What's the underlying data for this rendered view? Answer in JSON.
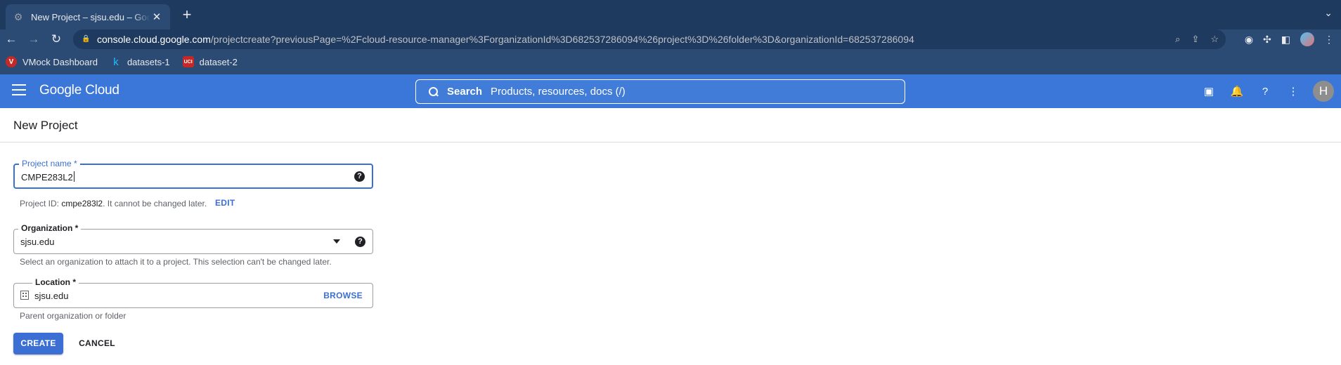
{
  "browser": {
    "tab_title": "New Project – sjsu.edu – Google Cloud console",
    "tab_close": "✕",
    "new_tab": "+",
    "url_host": "console.cloud.google.com",
    "url_path": "/projectcreate?previousPage=%2Fcloud-resource-manager%3ForganizationId%3D682537286094%26project%3D%26folder%3D&organizationId=682537286094",
    "bookmarks": [
      {
        "label": "VMock Dashboard",
        "icon": "vmock-icon",
        "color": "#c62828"
      },
      {
        "label": "datasets-1",
        "icon": "kaggle-icon",
        "color": "#20beff"
      },
      {
        "label": "dataset-2",
        "icon": "uci-icon",
        "color": "#c62828"
      }
    ]
  },
  "header": {
    "logo": "Google Cloud",
    "search_label": "Search",
    "search_placeholder": "Products, resources, docs (/)",
    "avatar_initial": "H",
    "accent_color": "#3b77d8"
  },
  "page": {
    "title": "New Project",
    "project_name": {
      "label": "Project name *",
      "value": "CMPE283L2"
    },
    "project_id": {
      "prefix": "Project ID: ",
      "id": "cmpe283l2",
      "suffix": ". It cannot be changed later.",
      "edit_label": "EDIT"
    },
    "organization": {
      "label": "Organization *",
      "value": "sjsu.edu",
      "hint": "Select an organization to attach it to a project. This selection can't be changed later."
    },
    "location": {
      "label": "Location *",
      "value": "sjsu.edu",
      "browse_label": "BROWSE",
      "hint": "Parent organization or folder"
    },
    "create_label": "CREATE",
    "cancel_label": "CANCEL"
  }
}
